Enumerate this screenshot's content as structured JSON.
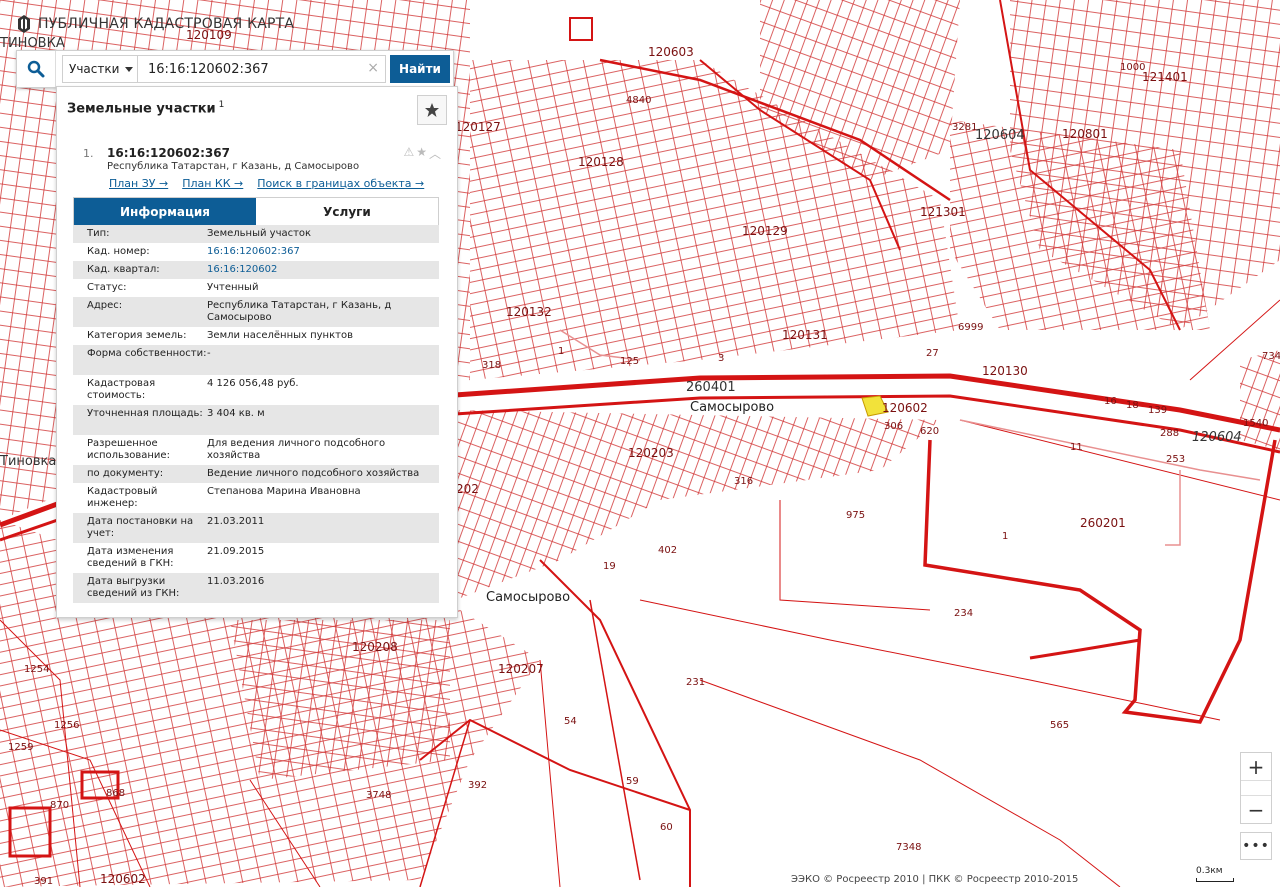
{
  "app": {
    "title": "ПУБЛИЧНАЯ КАДАСТРОВАЯ КАРТА"
  },
  "search": {
    "type_selected": "Участки",
    "query": "16:16:120602:367",
    "find_label": "Найти"
  },
  "panel": {
    "heading": "Земельные участки",
    "count": "1"
  },
  "result": {
    "index": "1.",
    "cad_number": "16:16:120602:367",
    "address": "Республика Татарстан, г Казань, д Самосырово",
    "links": [
      "План ЗУ →",
      "План КК →",
      "Поиск в границах объекта →"
    ]
  },
  "tabs": [
    "Информация",
    "Услуги"
  ],
  "info": [
    {
      "k": "Тип:",
      "v": "Земельный участок"
    },
    {
      "k": "Кад. номер:",
      "v": "16:16:120602:367"
    },
    {
      "k": "Кад. квартал:",
      "v": "16:16:120602"
    },
    {
      "k": "Статус:",
      "v": "Учтенный"
    },
    {
      "k": "Адрес:",
      "v": "Республика Татарстан, г Казань, д Самосырово"
    },
    {
      "k": "Категория земель:",
      "v": "Земли населённых пунктов"
    },
    {
      "k": "Форма собственности:",
      "v": "-"
    },
    {
      "k": "Кадастровая стоимость:",
      "v": "4 126 056,48 руб."
    },
    {
      "k": "Уточненная площадь:",
      "v": "3 404 кв. м"
    },
    {
      "k": "Разрешенное использование:",
      "v": "Для ведения личного подсобного хозяйства"
    },
    {
      "k": "по документу:",
      "v": "Ведение личного подсобного хозяйства"
    },
    {
      "k": "Кадастровый инженер:",
      "v": "Степанова Марина Ивановна"
    },
    {
      "k": "Дата постановки на учет:",
      "v": "21.03.2011"
    },
    {
      "k": "Дата изменения сведений в ГКН:",
      "v": "21.09.2015"
    },
    {
      "k": "Дата выгрузки сведений из ГКН:",
      "v": "11.03.2016"
    }
  ],
  "map": {
    "labels": [
      "120109",
      "120603",
      "4840",
      "120127",
      "120128",
      "120129",
      "121301",
      "120604",
      "120801",
      "121401",
      "1000",
      "3281",
      "120132",
      "120131",
      "120130",
      "260401",
      "Самосырово",
      "120602",
      "120604",
      "306",
      "620",
      "16",
      "18",
      "139",
      "288",
      "253",
      "120203",
      "316",
      "975",
      "260201",
      "1",
      "402",
      "19",
      "Самосырово",
      "234",
      "120208",
      "120207",
      "54",
      "231",
      "565",
      "59",
      "60",
      "3748",
      "392",
      "7348",
      "1254",
      "1256",
      "1259",
      "870",
      "868",
      "391",
      "120602",
      "1540",
      "734",
      "6999",
      "27",
      "125",
      "3",
      "1",
      "318",
      "11",
      "202",
      "ТИНОВКА",
      "Tиновка"
    ]
  },
  "zoom": {
    "in": "+",
    "out": "−",
    "more": "•••"
  },
  "footer": "ЭЭКО © Росреестр 2010 | ПКК © Росреестр 2010-2015",
  "scale": "0.3км"
}
